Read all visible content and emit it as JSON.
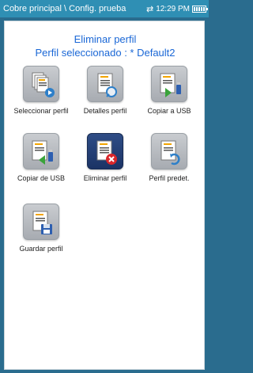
{
  "statusbar": {
    "breadcrumb": "Cobre principal \\ Config. prueba",
    "sync_icon": "sync-arrows-icon",
    "time": "12:29 PM",
    "battery_icon": "battery-icon"
  },
  "main": {
    "title": "Eliminar perfil",
    "subtitle": "Perfil seleccionado : * Default2"
  },
  "tiles": [
    {
      "label": "Seleccionar perfil",
      "icon": "select-profile-icon"
    },
    {
      "label": "Detalles perfil",
      "icon": "profile-details-icon"
    },
    {
      "label": "Copiar a USB",
      "icon": "copy-to-usb-icon"
    },
    {
      "label": "Copiar de USB",
      "icon": "copy-from-usb-icon"
    },
    {
      "label": "Eliminar perfil",
      "icon": "delete-profile-icon"
    },
    {
      "label": "Perfil predet.",
      "icon": "default-profile-icon"
    },
    {
      "label": "Guardar perfil",
      "icon": "save-profile-icon"
    }
  ],
  "colors": {
    "statusbar_bg": "#2f8fb4",
    "title_color": "#1a67d6",
    "active_tile_bg": "#1b3365"
  }
}
